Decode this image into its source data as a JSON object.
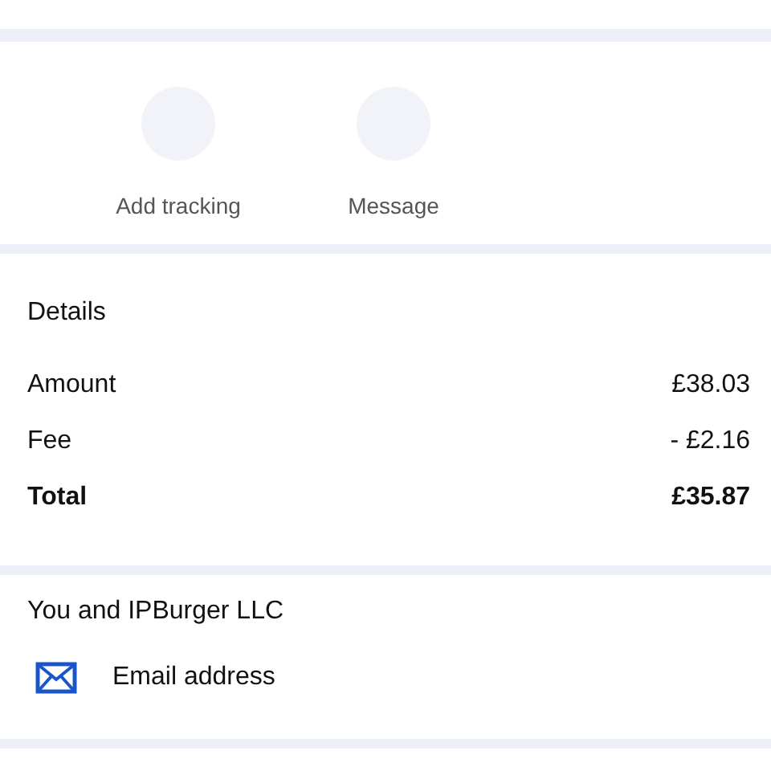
{
  "actions": [
    {
      "label": "Add tracking"
    },
    {
      "label": "Message"
    }
  ],
  "details": {
    "title": "Details",
    "rows": [
      {
        "label": "Amount",
        "value": "£38.03",
        "kind": "normal"
      },
      {
        "label": "Fee",
        "value": "- £2.16",
        "kind": "normal"
      },
      {
        "label": "Total",
        "value": "£35.87",
        "kind": "total"
      }
    ]
  },
  "contact": {
    "title": "You and IPBurger LLC",
    "items": [
      {
        "label": "Email address"
      }
    ]
  }
}
